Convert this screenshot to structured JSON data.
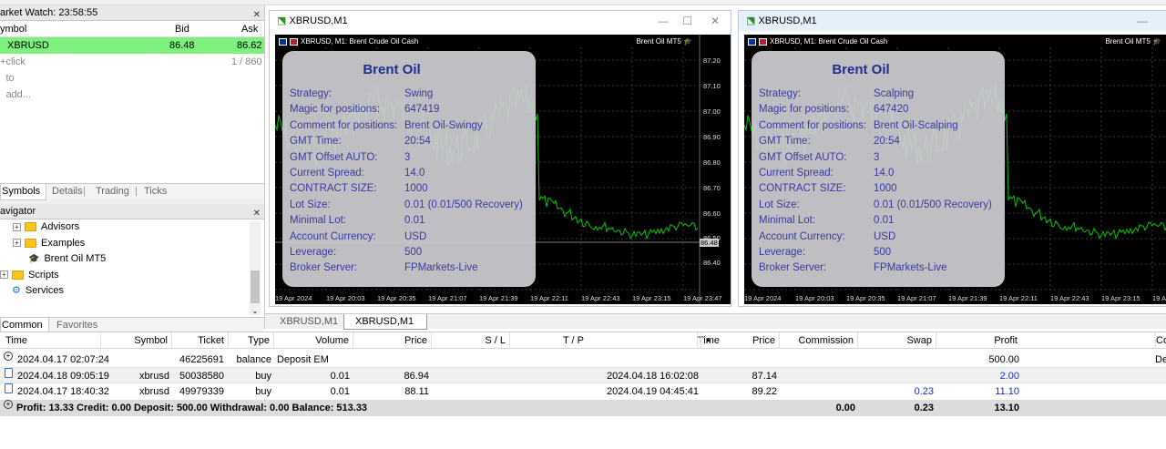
{
  "market_watch": {
    "title": "arket Watch: 23:58:55",
    "col_symbol": "ymbol",
    "col_bid": "Bid",
    "col_ask": "Ask",
    "rows": [
      {
        "symbol": "XBRUSD",
        "bid": "86.48",
        "ask": "86.62"
      }
    ],
    "add_label": "click to add...",
    "count": "1 / 860",
    "tabs": [
      "Symbols",
      "Details",
      "Trading",
      "Ticks"
    ]
  },
  "navigator": {
    "title": "avigator",
    "items": [
      "Advisors",
      "Examples",
      "Brent Oil MT5",
      "Scripts",
      "Services"
    ],
    "tabs": [
      "Common",
      "Favorites"
    ]
  },
  "charts": [
    {
      "window_title": "XBRUSD,M1",
      "header": "XBRUSD, M1:  Brent Crude Oil Cash",
      "brand": "Brent Oil MT5",
      "info_title": "Brent Oil",
      "info": [
        {
          "label": "Strategy:",
          "value": "Swing"
        },
        {
          "label": "Magic for positions:",
          "value": "647419"
        },
        {
          "label": "Comment for positions:",
          "value": "Brent Oil-Swingy"
        },
        {
          "label": "GMT Time:",
          "value": "20:54"
        },
        {
          "label": "GMT Offset AUTO:",
          "value": "3"
        },
        {
          "label": "Current Spread:",
          "value": "14.0"
        },
        {
          "label": "CONTRACT SIZE:",
          "value": "1000"
        },
        {
          "label": "Lot Size:",
          "value": "0.01 (0.01/500 Recovery)"
        },
        {
          "label": "Minimal Lot:",
          "value": "0.01"
        },
        {
          "label": "Account Currency:",
          "value": "USD"
        },
        {
          "label": "Leverage:",
          "value": "500"
        },
        {
          "label": "Broker Server:",
          "value": "FPMarkets-Live"
        }
      ],
      "price_labels": [
        "87.20",
        "87.10",
        "87.00",
        "86.90",
        "86.80",
        "86.70",
        "86.60",
        "86.50",
        "86.40"
      ],
      "current_price": "86.48",
      "time_labels": [
        "19 Apr 2024",
        "19 Apr 20:03",
        "19 Apr 20:35",
        "19 Apr 21:07",
        "19 Apr 21:39",
        "19 Apr 22:11",
        "19 Apr 22:43",
        "19 Apr 23:15",
        "19 Apr 23:47"
      ]
    },
    {
      "window_title": "XBRUSD,M1",
      "header": "XBRUSD, M1:  Brent Crude Oil Cash",
      "brand": "Brent Oil MT5",
      "info_title": "Brent Oil",
      "info": [
        {
          "label": "Strategy:",
          "value": "Scalping"
        },
        {
          "label": "Magic for positions:",
          "value": "647420"
        },
        {
          "label": "Comment for positions:",
          "value": "Brent Oil-Scalping"
        },
        {
          "label": "GMT Time:",
          "value": "20:54"
        },
        {
          "label": "GMT Offset AUTO:",
          "value": "3"
        },
        {
          "label": "Current Spread:",
          "value": "14.0"
        },
        {
          "label": "CONTRACT SIZE:",
          "value": "1000"
        },
        {
          "label": "Lot Size:",
          "value": "0.01 (0.01/500 Recovery)"
        },
        {
          "label": "Minimal Lot:",
          "value": "0.01"
        },
        {
          "label": "Account Currency:",
          "value": "USD"
        },
        {
          "label": "Leverage:",
          "value": "500"
        },
        {
          "label": "Broker Server:",
          "value": "FPMarkets-Live"
        }
      ],
      "time_labels": [
        "19 Apr 2024",
        "19 Apr 20:03",
        "19 Apr 20:35",
        "19 Apr 21:07",
        "19 Apr 21:39",
        "19 Apr 22:11",
        "19 Apr 22:43",
        "19 Apr 23:15",
        "19 Apr 23:4"
      ]
    }
  ],
  "chart_tabs": [
    "XBRUSD,M1",
    "XBRUSD,M1"
  ],
  "terminal": {
    "headers": {
      "time": "Time",
      "symbol": "Symbol",
      "ticket": "Ticket",
      "type": "Type",
      "volume": "Volume",
      "price": "Price",
      "sl": "S / L",
      "tp": "T / P",
      "time2": "Time",
      "price2": "Price",
      "commission": "Commission",
      "swap": "Swap",
      "profit": "Profit",
      "comment": "Co"
    },
    "rows": [
      {
        "time": "2024.04.17 02:07:24",
        "symbol": "",
        "ticket": "46225691",
        "type": "balance",
        "volume": "Deposit EM",
        "price": "",
        "time2": "",
        "price2": "",
        "commission": "",
        "swap": "",
        "profit": "500.00",
        "comment": "Dep"
      },
      {
        "time": "2024.04.18 09:05:19",
        "symbol": "xbrusd",
        "ticket": "50038580",
        "type": "buy",
        "volume": "0.01",
        "price": "86.94",
        "time2": "2024.04.18 16:02:08",
        "price2": "87.14",
        "commission": "",
        "swap": "",
        "profit": "2.00",
        "comment": ""
      },
      {
        "time": "2024.04.17 18:40:32",
        "symbol": "xbrusd",
        "ticket": "49979339",
        "type": "buy",
        "volume": "0.01",
        "price": "88.11",
        "time2": "2024.04.19 04:45:41",
        "price2": "89.22",
        "commission": "",
        "swap": "0.23",
        "profit": "11.10",
        "comment": ""
      }
    ],
    "summary": {
      "text": "Profit: 13.33  Credit: 0.00  Deposit: 500.00  Withdrawal: 0.00  Balance: 513.33",
      "commission": "0.00",
      "swap": "0.23",
      "profit": "13.10"
    }
  },
  "colors": {
    "selected_row": "#7df07d",
    "chart_bg": "#000000",
    "candles": "#00c800",
    "info_text": "#3a3aa0"
  }
}
